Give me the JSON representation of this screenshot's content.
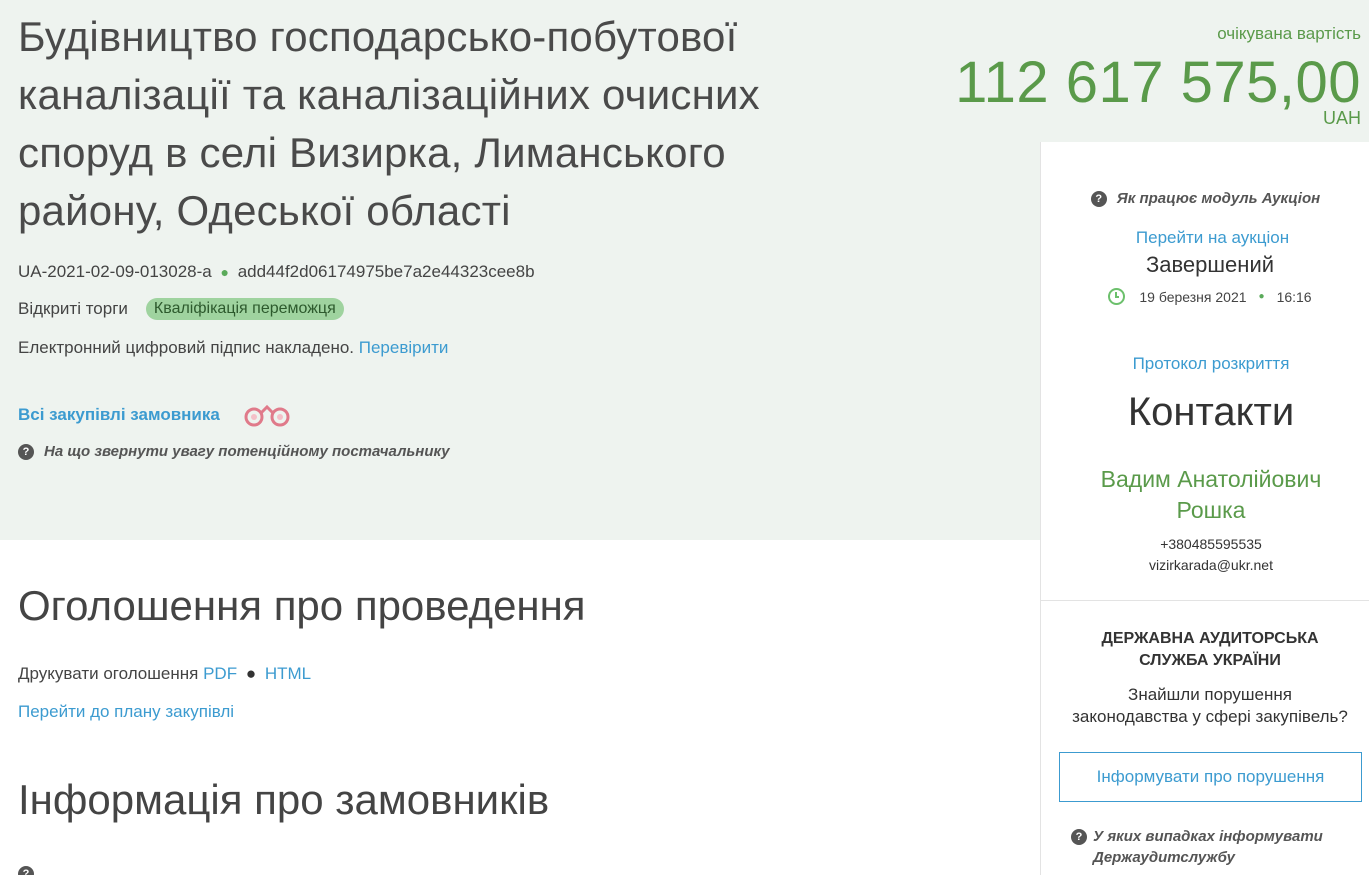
{
  "tender": {
    "title": "Будівництво господарсько-побутової каналізації та каналізаційних очисних споруд в селі Визирка, Лиманського району, Одеської області",
    "title_display": "Будівництво господарсько-побутової каналізації та каналізаційних очисних споруд в селі Визирка, Лиманського району, Одеської області",
    "tender_id": "UA-2021-02-09-013028-a",
    "hash": "add44f2d06174975be7a2e44323cee8b",
    "procedure_type": "Відкриті торги",
    "status_badge": "Кваліфікація переможця",
    "signature_text": "Електронний цифровий підпис накладено.",
    "signature_check": "Перевірити",
    "all_buyer_label": "Всі закупівлі замовника",
    "attention_label": "На що звернути увагу потенційному постачальнику"
  },
  "price": {
    "label": "очікувана вартість",
    "amount": "112 617 575,00",
    "currency": "UAH"
  },
  "auction": {
    "help_label": "Як працює модуль Аукціон",
    "link_label": "Перейти на аукціон",
    "status": "Завершений",
    "date": "19 березня 2021",
    "time": "16:16",
    "protocol_label": "Протокол розкриття"
  },
  "contacts": {
    "title": "Контакти",
    "name_line1": "Вадим Анатолійович",
    "name_line2": "Рошка",
    "phone": "+380485595535",
    "email": "vizirkarada@ukr.net"
  },
  "audit": {
    "title_line1": "ДЕРЖАВНА АУДИТОРСЬКА",
    "title_line2": "СЛУЖБА УКРАЇНИ",
    "question_line1": "Знайшли порушення",
    "question_line2": "законодавства у сфері закупівель?",
    "button_label": "Інформувати про порушення",
    "when_label": "У яких випадках інформувати Держаудитслужбу"
  },
  "announcement": {
    "title": "Оголошення про проведення",
    "print_label": "Друкувати оголошення",
    "pdf_label": "PDF",
    "html_label": "HTML",
    "plan_link": "Перейти до плану закупівлі"
  },
  "buyers": {
    "title": "Інформація про замовників"
  },
  "icons": {
    "binoculars": "binoculars-icon",
    "question": "question-icon",
    "clock": "clock-icon"
  },
  "colors": {
    "link": "#3c9bd0",
    "price": "#5a9a4a",
    "badge_bg": "#9fd39f",
    "header_bg": "#eef3ef"
  }
}
